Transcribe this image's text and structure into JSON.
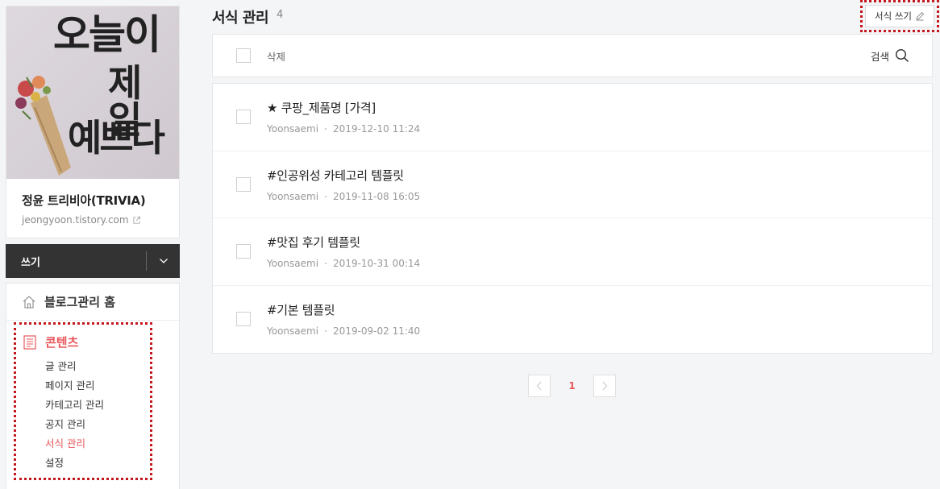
{
  "profile": {
    "image_text": [
      "오늘이",
      "제일",
      "예쁘다"
    ],
    "blog_name": "정윤 트리비아(TRIVIA)",
    "blog_url": "jeongyoon.tistory.com"
  },
  "write": {
    "label": "쓰기"
  },
  "menu": {
    "home_label": "블로그관리 홈",
    "contents_label": "콘텐츠",
    "sub_items": [
      {
        "label": "글 관리"
      },
      {
        "label": "페이지 관리"
      },
      {
        "label": "카테고리 관리"
      },
      {
        "label": "공지 관리"
      },
      {
        "label": "서식 관리",
        "active": true
      },
      {
        "label": "설정"
      }
    ]
  },
  "header": {
    "title": "서식 관리",
    "count": "4",
    "new_button_label": "서식 쓰기"
  },
  "toolbar": {
    "delete_label": "삭제",
    "search_label": "검색"
  },
  "templates": [
    {
      "title": "★ 쿠팡_제품명 [가격]",
      "author": "Yoonsaemi",
      "date": "2019-12-10 11:24"
    },
    {
      "title": "#인공위성 카테고리 템플릿",
      "author": "Yoonsaemi",
      "date": "2019-11-08 16:05"
    },
    {
      "title": "#맛집 후기 템플릿",
      "author": "Yoonsaemi",
      "date": "2019-10-31 00:14"
    },
    {
      "title": "#기본 템플릿",
      "author": "Yoonsaemi",
      "date": "2019-09-02 11:40"
    }
  ],
  "pagination": {
    "current": "1"
  },
  "colors": {
    "accent": "#e8565a",
    "highlight_border": "#c4161c",
    "write_bar": "#333333",
    "background": "#f4f5f7"
  }
}
